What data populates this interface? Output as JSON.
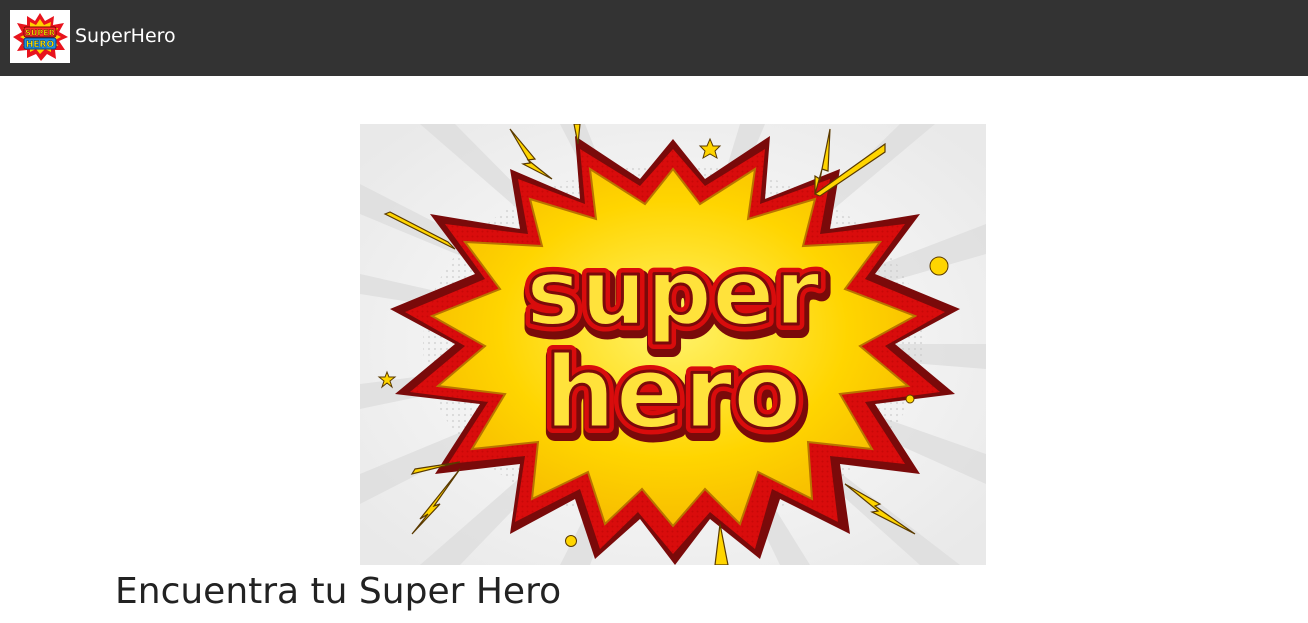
{
  "navbar": {
    "brand_label": "SuperHero",
    "logo_icon": "superhero-logo-icon",
    "background": "#333333"
  },
  "hero": {
    "image_icon": "superhero-comic-burst-image",
    "art_text_line1": "super",
    "art_text_line2": "hero",
    "colors": {
      "yellow": "#ffd500",
      "red": "#d90c0c",
      "dark_red": "#7a0a0a"
    }
  },
  "main": {
    "headline": "Encuentra tu Super Hero"
  }
}
